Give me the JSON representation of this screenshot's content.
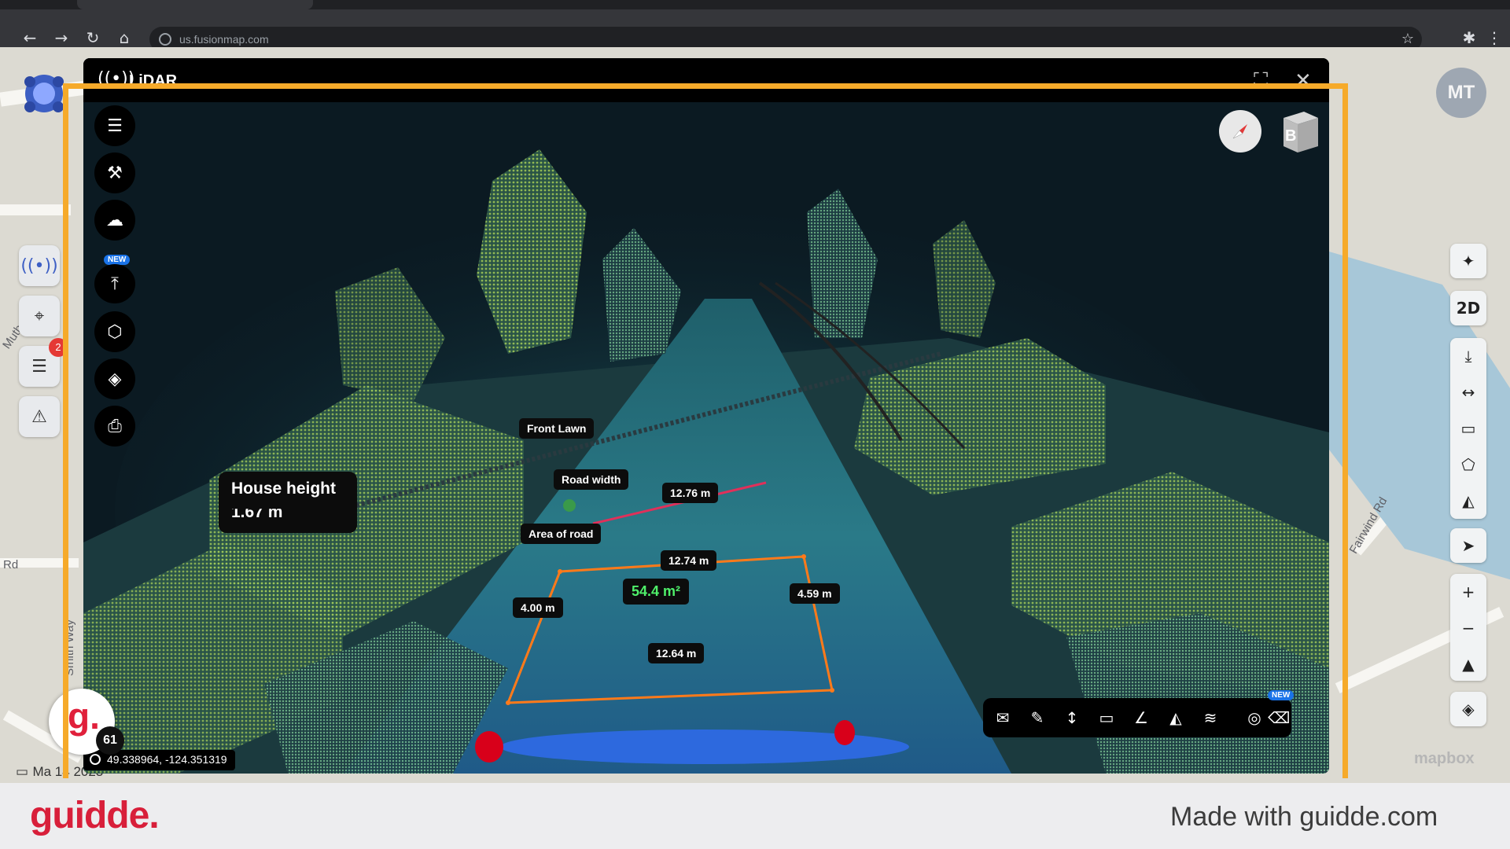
{
  "browser": {
    "url": "us.fusionmap.com",
    "icons": {
      "back": "←",
      "forward": "→",
      "reload": "↻",
      "home": "⌂",
      "star": "☆",
      "extensions": "✱",
      "menu": "⋮"
    }
  },
  "app": {
    "avatar_initials": "MT",
    "notification_count": "2",
    "map_labels": {
      "street_left": "Rd",
      "street_vertical": "Smith Way",
      "street_right": "Fairwind Rd",
      "street_top_left": "Muth"
    },
    "date_text": "Ma  14 2023",
    "mapbox": "mapbox",
    "right_rail": {
      "view_2d": "2D"
    }
  },
  "lidar": {
    "title": "LiDAR",
    "new_badge": "NEW",
    "house_label": {
      "title": "House height",
      "value": "1.67 m"
    },
    "labels": {
      "front_lawn": "Front Lawn",
      "road_width": "Road width",
      "area_of_road": "Area of road"
    },
    "measurements": {
      "road_width_value": "12.76 m",
      "top_edge": "12.74 m",
      "area": "54.4 m²",
      "left_edge": "4.00 m",
      "right_edge": "4.59 m",
      "bottom_edge": "12.64 m"
    },
    "view_cube_face": "B",
    "toolbar_new_badge": "NEW",
    "coordinates": "49.338964, -124.351319",
    "step_number": "61"
  },
  "footer": {
    "logo": "guidde.",
    "made_with": "Made with guidde.com"
  },
  "colors": {
    "highlight": "#f6aa2a",
    "brand": "#d81f3a",
    "area_text": "#4ff06a",
    "measure_line": "#ff7a1a",
    "road_width_line": "#e0305a"
  }
}
